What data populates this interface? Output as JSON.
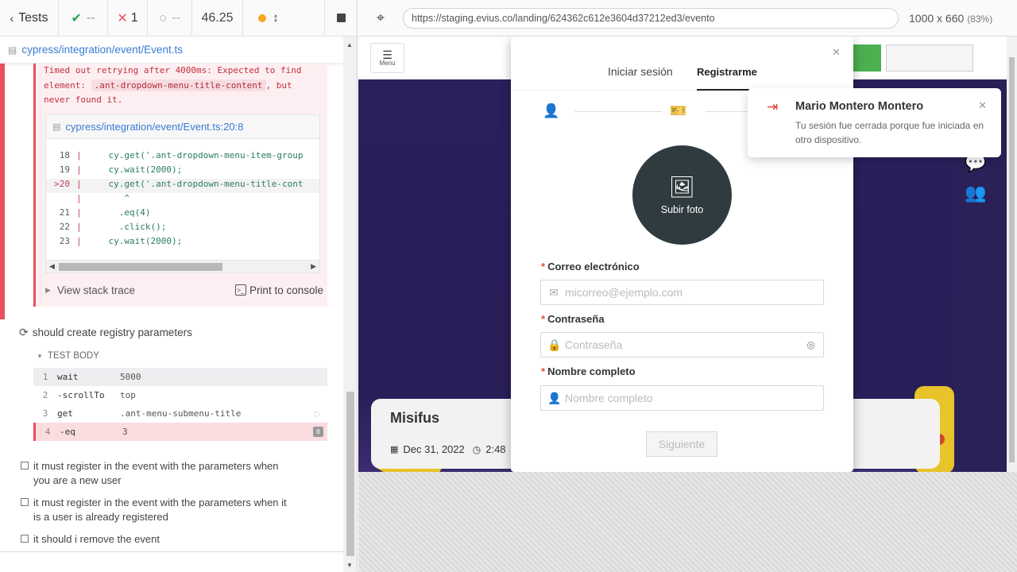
{
  "runner": {
    "tests_label": "Tests",
    "passed": "--",
    "failed": "1",
    "pending": "--",
    "duration": "46.25",
    "spec_path": "cypress/integration/event/Event.ts"
  },
  "error": {
    "message_pre": "Timed out retrying after 4000ms: Expected to find element: ",
    "selector": ".ant-dropdown-menu-title-content",
    "message_post": ", but never found it.",
    "frame_path": "cypress/integration/event/Event.ts:20:8",
    "code_lines": [
      {
        "n": "18",
        "src": "    cy.get('.ant-dropdown-menu-item-group"
      },
      {
        "n": "19",
        "src": "    cy.wait(2000);"
      },
      {
        "n": "20",
        "src": "    cy.get('.ant-dropdown-menu-title-cont"
      },
      {
        "n": "",
        "src": "       ^"
      },
      {
        "n": "21",
        "src": "      .eq(4)"
      },
      {
        "n": "22",
        "src": "      .click();"
      },
      {
        "n": "23",
        "src": "    cy.wait(2000);"
      }
    ],
    "stack_trace_label": "View stack trace",
    "print_label": "Print to console"
  },
  "current_test": {
    "title": "should create registry parameters",
    "body_label": "TEST BODY",
    "commands": [
      {
        "n": "1",
        "name": "wait",
        "arg": "5000"
      },
      {
        "n": "2",
        "name": "-scrollTo",
        "arg": "top"
      },
      {
        "n": "3",
        "name": "get",
        "arg": ".ant-menu-submenu-title"
      },
      {
        "n": "4",
        "name": "-eq",
        "arg": "3",
        "badge": "0"
      }
    ]
  },
  "pending_tests": [
    "it must register in the event with the parameters when you are a new user",
    "it must register in the event with the parameters when it is a user is already registered",
    "it should i remove the event"
  ],
  "browser": {
    "url": "https://staging.evius.co/landing/624362c612e3604d37212ed3/evento",
    "viewport": "1000 x 660",
    "zoom": "(83%)"
  },
  "app": {
    "menu_label": "Menu",
    "event_title": "Misifus",
    "event_date": "Dec 31, 2022",
    "event_time": "2:48"
  },
  "modal": {
    "tab_login": "Iniciar sesión",
    "tab_register": "Registrarme",
    "upload_photo": "Subir foto",
    "email_label": "Correo electrónico",
    "email_placeholder": "micorreo@ejemplo.com",
    "password_label": "Contraseña",
    "password_placeholder": "Contraseña",
    "name_label": "Nombre completo",
    "name_placeholder": "Nombre completo",
    "next_button": "Siguiente"
  },
  "toast": {
    "title": "Mario Montero Montero",
    "message": "Tu sesión fue cerrada porque fue iniciada en otro dispositivo."
  },
  "colors": {
    "fail_red": "#e94f5f",
    "link_blue": "#3a7bd5",
    "stage_purple": "#2a1f5e",
    "avatar_dark": "#2f3b3f",
    "toast_icon_red": "#e53935"
  }
}
